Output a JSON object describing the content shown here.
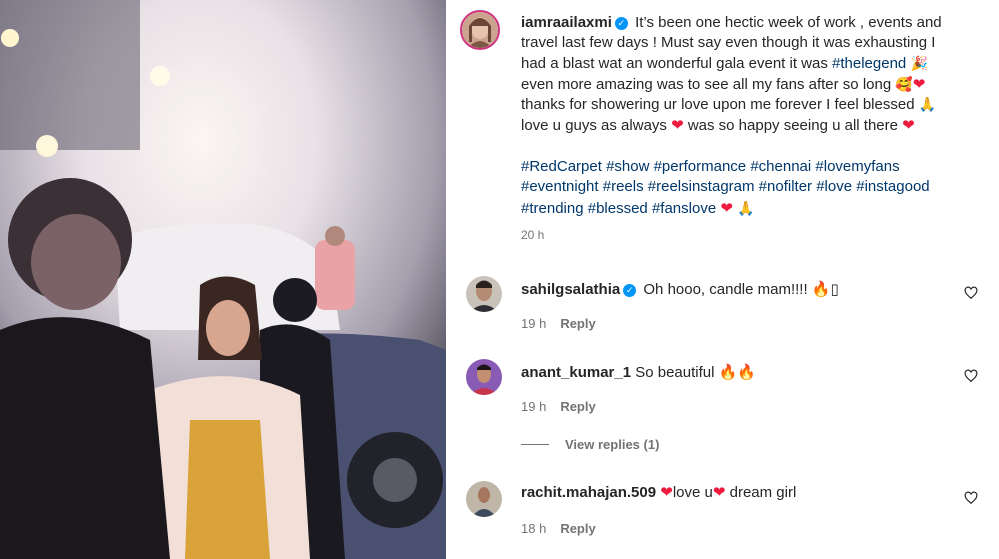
{
  "post": {
    "author": "iamraailaxmi",
    "caption_lines": {
      "l1": "It’s been one hectic week of work , events and",
      "l2": "travel last few days ! Must say even though it was exhausting I",
      "l3": "had a blast wat an wonderful gala event it was",
      "l3_tag": "#thelegend",
      "l4": "even more amazing was to see all my fans after so long",
      "l5": "thanks for showering ur love upon me forever I feel blessed",
      "l6a": "love u guys as always",
      "l6b": "was so happy seeing u all there"
    },
    "hashtags": [
      "#RedCarpet",
      "#show",
      "#performance",
      "#chennai",
      "#lovemyfans",
      "#eventnight",
      "#reels",
      "#reelsinstagram",
      "#nofilter",
      "#love",
      "#instagood",
      "#trending",
      "#blessed",
      "#fanslove"
    ],
    "time": "20 h"
  },
  "comments": [
    {
      "username": "sahilgsalathia",
      "text": "Oh hooo, candle mam!!!! 🔥▯",
      "time": "19 h",
      "reply": "Reply",
      "verified": true
    },
    {
      "username": "anant_kumar_1",
      "text": "So beautiful 🔥🔥",
      "time": "19 h",
      "reply": "Reply",
      "verified": false
    },
    {
      "username": "rachit.mahajan.509",
      "text_parts": [
        "love u",
        "dream girl"
      ],
      "time": "18 h",
      "reply": "Reply",
      "verified": false
    }
  ],
  "view_replies": "View replies (1)",
  "icons": {
    "verified": "verified-badge-icon",
    "like": "heart-outline-icon",
    "party": "party-popper-icon",
    "smile": "smiling-face-icon",
    "pray": "folded-hands-icon",
    "heart": "red-heart-icon",
    "fire": "fire-icon"
  },
  "colors": {
    "hashtag": "#00376b",
    "verified": "#0095f6",
    "muted": "#737373",
    "heart": "#ed1c3f"
  }
}
